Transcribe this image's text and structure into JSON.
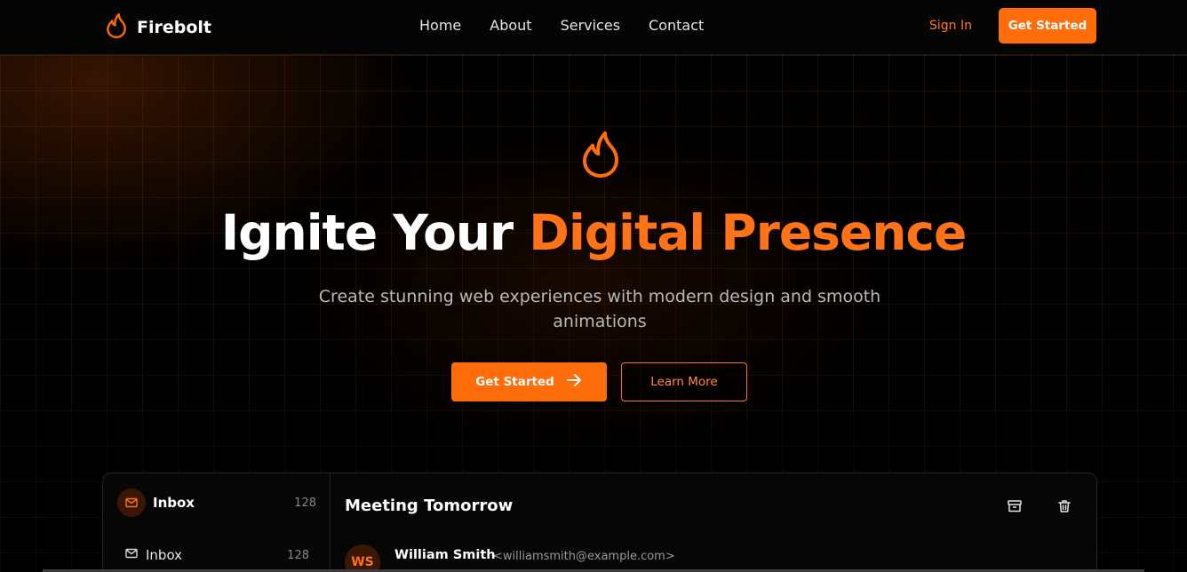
{
  "brand": {
    "name": "Firebolt"
  },
  "nav": [
    "Home",
    "About",
    "Services",
    "Contact"
  ],
  "header_actions": {
    "sign_in": "Sign In",
    "get_started": "Get Started"
  },
  "hero": {
    "title_part1": "Ignite Your ",
    "title_accent": "Digital Presence",
    "subtitle": "Create stunning web experiences with modern design and smooth animations",
    "primary_cta": "Get Started",
    "secondary_cta": "Learn More"
  },
  "mail_preview": {
    "account": {
      "label": "Inbox",
      "count": "128"
    },
    "folders": [
      {
        "label": "Inbox",
        "count": "128"
      }
    ],
    "subject": "Meeting Tomorrow",
    "sender": {
      "initials": "WS",
      "name": "William Smith",
      "email": "<williamsmith@example.com>"
    }
  },
  "colors": {
    "accent": "#ff6d0a",
    "background": "#000000"
  },
  "icons": [
    "flame-icon",
    "arrow-right-icon",
    "mail-icon",
    "archive-icon",
    "trash-icon"
  ]
}
